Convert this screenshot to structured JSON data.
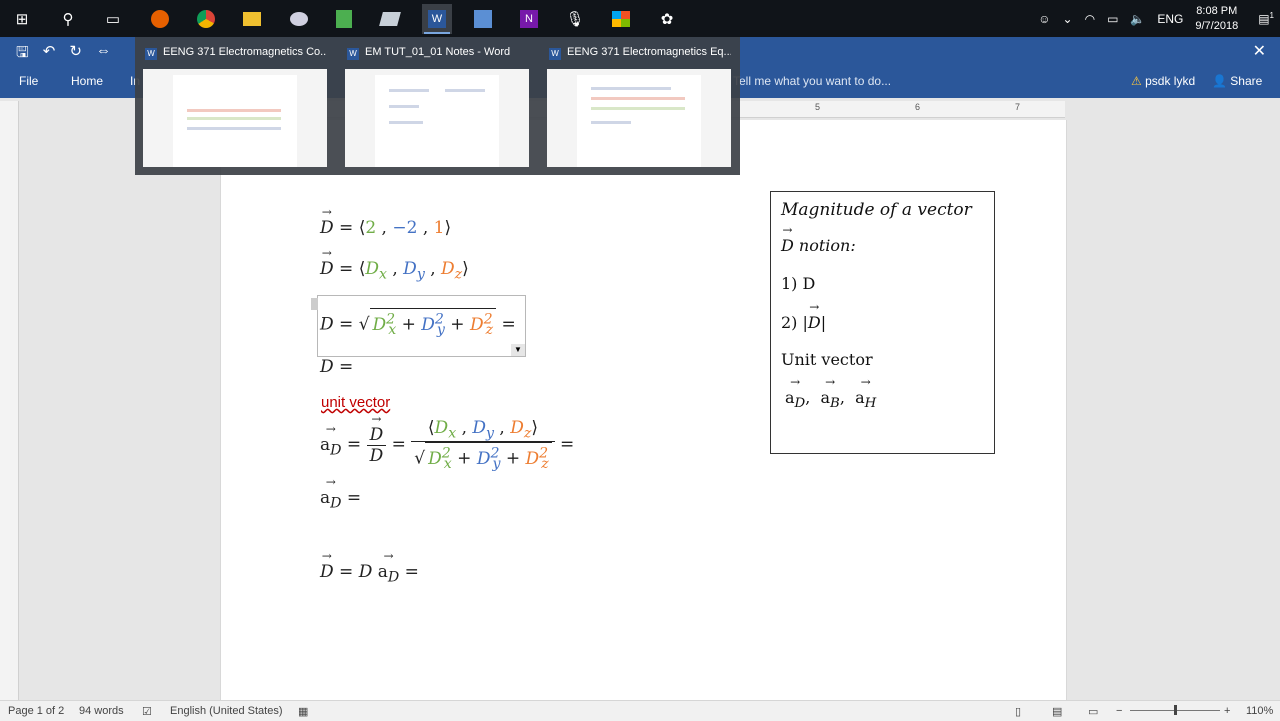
{
  "taskbar": {
    "icons": [
      "windows-icon",
      "search-icon",
      "task-view-icon",
      "firefox-icon",
      "chrome-icon",
      "file-explorer-icon",
      "paint-icon",
      "spreadsheet-icon",
      "notepad-icon",
      "word-icon",
      "tool-icon",
      "onenote-icon",
      "microphone-icon",
      "store-icon",
      "settings-app-icon"
    ],
    "lang": "ENG",
    "time": "8:08 PM",
    "date": "9/7/2018",
    "notif_count": "1"
  },
  "ribbon": {
    "tabs": [
      "File",
      "Home",
      "In"
    ],
    "tell_me": "Tell me what you want to do...",
    "user": "psdk lykd",
    "share": "Share"
  },
  "thumbnails": [
    {
      "title": "EENG 371 Electromagnetics Co..."
    },
    {
      "title": "EM TUT_01_01 Notes - Word"
    },
    {
      "title": "EENG 371 Electromagnetics Eq..."
    }
  ],
  "ruler_marks": [
    "5",
    "6",
    "7"
  ],
  "document": {
    "eq1": {
      "lhs": "D",
      "eq": " = ⟨",
      "v1": "2",
      "sep1": " , ",
      "v2": "−2",
      "sep2": " , ",
      "v3": "1",
      "close": "⟩"
    },
    "eq2": {
      "lhs": "D",
      "eq": " = ⟨",
      "v1": "D",
      "s1": "x",
      "sep1": " , ",
      "v2": "D",
      "s2": "y",
      "sep2": " , ",
      "v3": "D",
      "s3": "z",
      "close": "⟩"
    },
    "eq3": {
      "lhs": "D = ",
      "trail": " ="
    },
    "eq4": "D =",
    "unit_vector_label": "unit vector",
    "eq5": {
      "a": "a",
      "sub": "D",
      "mid": " = ",
      "frac_den": "D",
      "trail": " ="
    },
    "eq6": {
      "a": "a",
      "sub": "D",
      "trail": " ="
    },
    "eq7": {
      "lhs": "D",
      "mid": " = D ",
      "a": "a",
      "sub": "D",
      "trail": " ="
    }
  },
  "sidebox": {
    "title": "Magnitude of a vector",
    "notation": "notion:",
    "item1": "1) D",
    "item2": "2)",
    "unit_vector": "Unit vector",
    "vectors": [
      "a",
      "a",
      "a"
    ],
    "subs": [
      "D",
      "B",
      "H"
    ]
  },
  "status": {
    "page": "Page 1 of 2",
    "words": "94 words",
    "language": "English (United States)",
    "zoom": "110%"
  }
}
